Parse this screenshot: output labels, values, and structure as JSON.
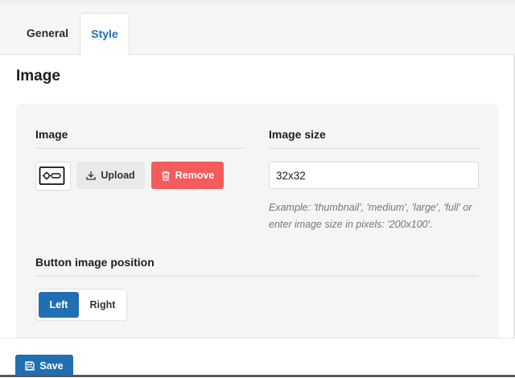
{
  "tabs": [
    {
      "label": "General",
      "active": false
    },
    {
      "label": "Style",
      "active": true
    }
  ],
  "section_title": "Image",
  "image_field": {
    "label": "Image",
    "thumbnail_icon": "image-placeholder-icon",
    "upload_label": "Upload",
    "remove_label": "Remove"
  },
  "image_size": {
    "label": "Image size",
    "value": "32x32",
    "help": "Example: 'thumbnail', 'medium', 'large', 'full' or enter image size in pixels: '200x100'."
  },
  "button_image_position": {
    "label": "Button image position",
    "options": [
      "Left",
      "Right"
    ],
    "selected": "Left"
  },
  "footer": {
    "save_label": "Save"
  },
  "colors": {
    "accent": "#1f6fb2",
    "danger": "#f45b5b",
    "panel_bg": "#f5f5f5"
  }
}
